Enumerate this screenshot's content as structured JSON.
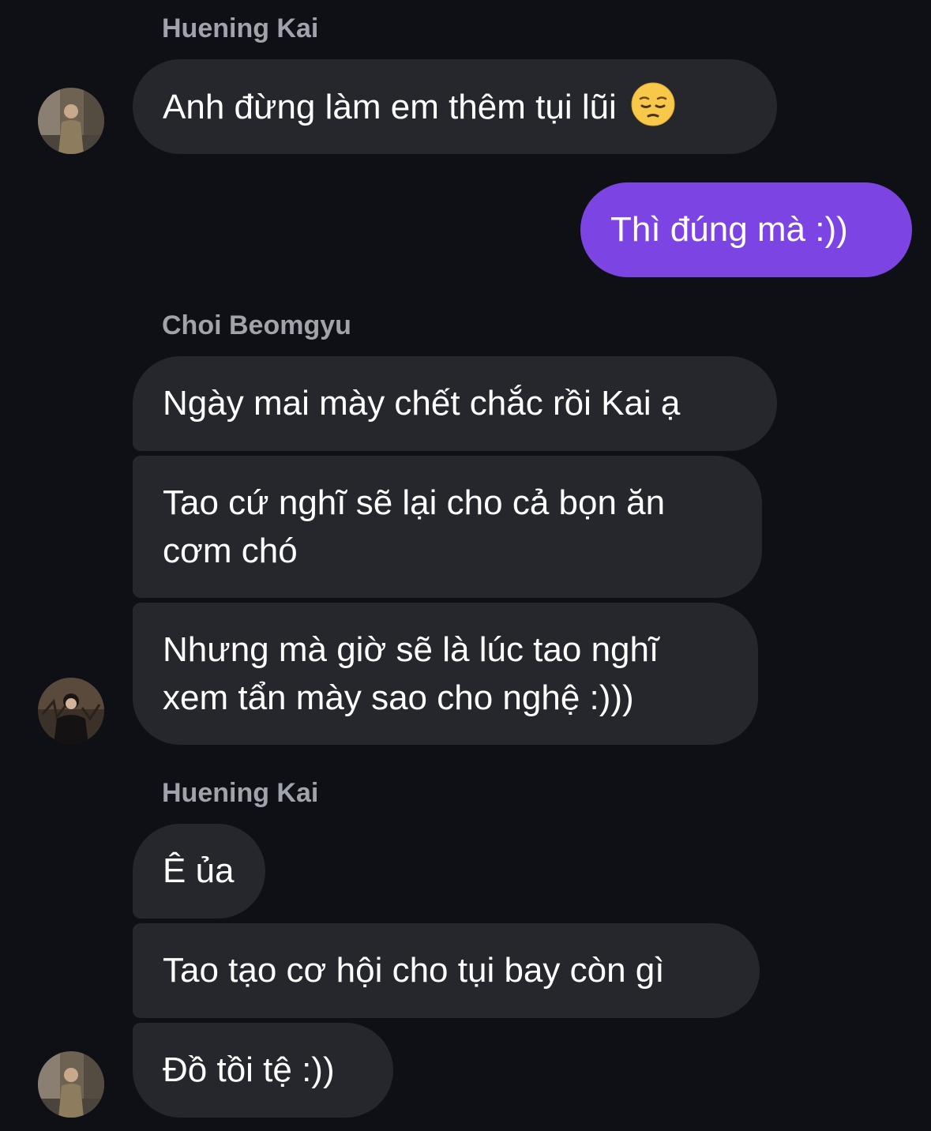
{
  "thread": {
    "groups": [
      {
        "sender": "Huening Kai",
        "messages": [
          "Anh đừng làm em thêm tụi lũi"
        ],
        "emoji": "pensive-face-emoji"
      },
      {
        "sender": "",
        "outgoing": true,
        "messages": [
          "Thì đúng mà :))"
        ]
      },
      {
        "sender": "Choi Beomgyu",
        "messages": [
          "Ngày mai mày chết chắc rồi Kai ạ",
          "Tao cứ nghĩ sẽ lại cho cả bọn ăn cơm chó",
          "Nhưng mà giờ sẽ là lúc tao nghĩ xem tẩn mày sao cho nghệ :)))"
        ]
      },
      {
        "sender": "Huening Kai",
        "messages": [
          "Ê ủa",
          "Tao tạo cơ hội cho tụi bay còn gì",
          "Đồ tồi tệ :))"
        ]
      }
    ]
  },
  "colors": {
    "background": "#0e1015",
    "incoming_bubble": "#25272c",
    "outgoing_bubble": "#7c45e3",
    "sender_name": "#a0a3ab"
  }
}
